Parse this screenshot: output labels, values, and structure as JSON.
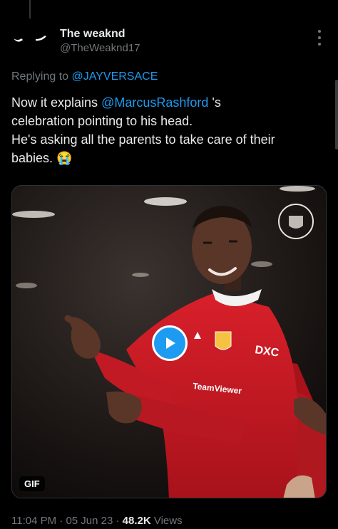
{
  "tweet": {
    "author": {
      "display_name": "The weaknd",
      "handle": "@TheWeaknd17",
      "avatar_icon": "eyes-avatar-icon"
    },
    "replying_to": {
      "prefix": "Replying to",
      "user": "@JAYVERSACE"
    },
    "text": {
      "line1_before": "Now it explains ",
      "line1_mention": "@MarcusRashford",
      "line1_after": " 's",
      "line2": "celebration pointing to his head.",
      "line3": "He's asking all the parents to take care of their",
      "line4": "babies. ",
      "emoji": "😭"
    },
    "media": {
      "type": "gif",
      "badge": "GIF",
      "play_icon": "play-icon"
    },
    "meta": {
      "time": "11:04 PM",
      "separator": " · ",
      "date": "05 Jun 23",
      "views_count": "48.2K",
      "views_label": " Views"
    }
  },
  "colors": {
    "background": "#000000",
    "text": "#e7e9ea",
    "secondary": "#71767b",
    "accent": "#1d9bf0"
  }
}
